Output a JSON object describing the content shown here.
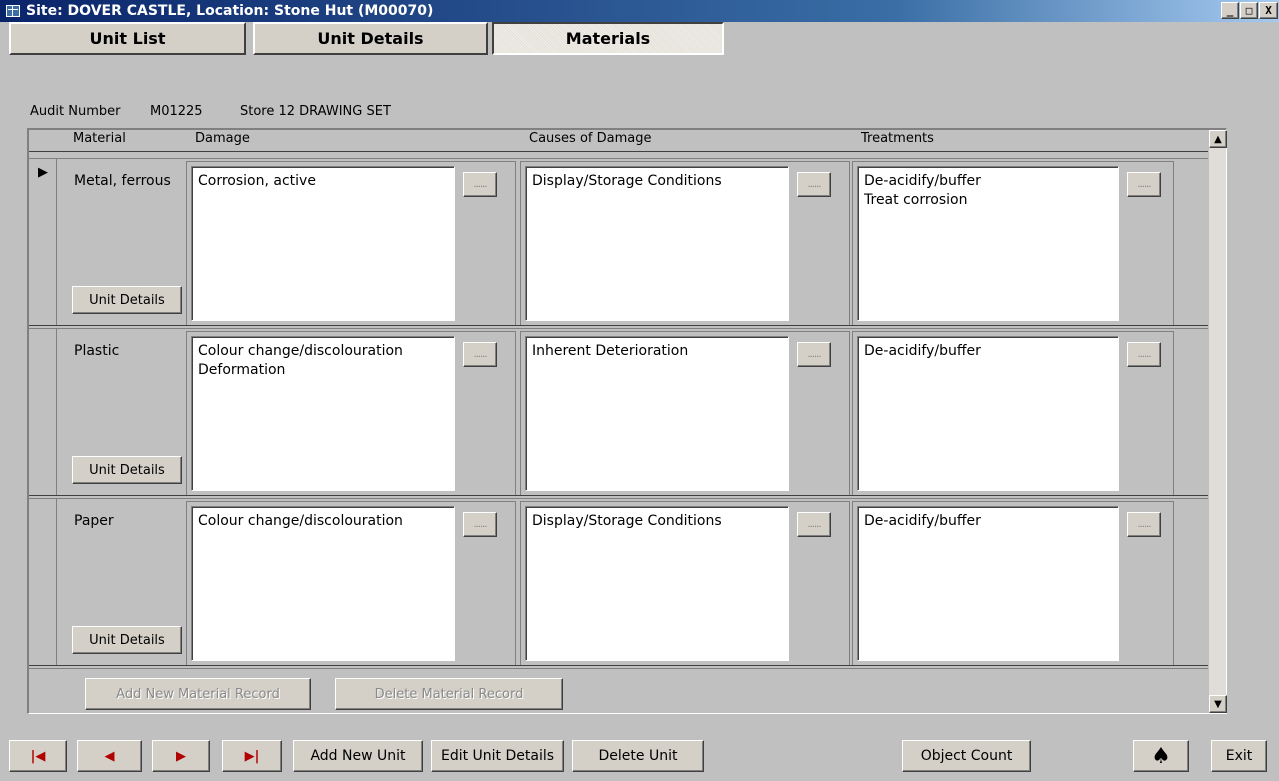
{
  "window": {
    "title": "Site: DOVER CASTLE,  Location: Stone Hut  (M00070)",
    "minimize": "_",
    "restore": "□",
    "close": "X"
  },
  "tabs": [
    {
      "label": "Unit List"
    },
    {
      "label": "Unit Details"
    },
    {
      "label": "Materials",
      "active": true
    }
  ],
  "audit": {
    "label": "Audit Number",
    "number": "M01225",
    "description": "Store 12 DRAWING SET"
  },
  "columns": {
    "material": "Material",
    "damage": "Damage",
    "causes": "Causes of Damage",
    "treatments": "Treatments"
  },
  "rows": [
    {
      "material": "Metal, ferrous",
      "damage": "Corrosion, active",
      "causes": "Display/Storage Conditions",
      "treatments": "De-acidify/buffer\nTreat corrosion",
      "unit_details_label": "Unit Details",
      "current": true
    },
    {
      "material": "Plastic",
      "damage": "Colour change/discolouration\nDeformation",
      "causes": "Inherent Deterioration",
      "treatments": "De-acidify/buffer",
      "unit_details_label": "Unit Details"
    },
    {
      "material": "Paper",
      "damage": "Colour change/discolouration",
      "causes": "Display/Storage Conditions",
      "treatments": "De-acidify/buffer",
      "unit_details_label": "Unit Details"
    }
  ],
  "lookup_button_label": "......",
  "record_buttons": {
    "add": "Add New Material Record",
    "delete": "Delete Material Record"
  },
  "bottom_bar": {
    "first": "|◀",
    "prev": "◀",
    "next": "▶",
    "last": "▶|",
    "add_unit": "Add New Unit",
    "edit_unit": "Edit Unit Details",
    "delete_unit": "Delete Unit",
    "object_count": "Object Count",
    "spade": "♠",
    "exit": "Exit"
  },
  "colors": {
    "title_gradient_start": "#0a246a",
    "nav_arrow": "#b00000",
    "face": "#d4d0c8"
  }
}
